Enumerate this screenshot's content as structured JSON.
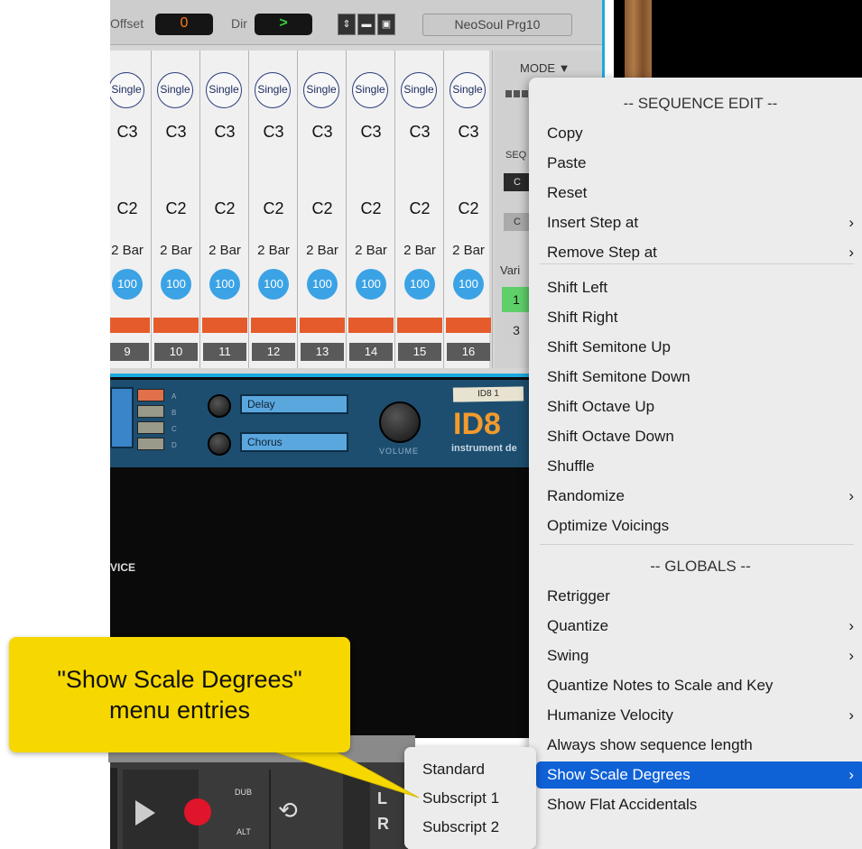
{
  "sequencer": {
    "offset_label": "Offset",
    "offset_value": "0",
    "dir_label": "Dir",
    "dir_value": ">",
    "preset_name": "NeoSoul Prg10",
    "mode_label": "MODE ▼",
    "partial_labels": {
      "seq": "SEQ",
      "c1": "C",
      "c2": "C",
      "var": "Vari",
      "v1": "1",
      "v3": "3"
    },
    "steps": [
      {
        "mode": "Single",
        "note_hi": "C3",
        "note_lo": "C2",
        "length": "2 Bar",
        "velocity": "100",
        "number": "9"
      },
      {
        "mode": "Single",
        "note_hi": "C3",
        "note_lo": "C2",
        "length": "2 Bar",
        "velocity": "100",
        "number": "10"
      },
      {
        "mode": "Single",
        "note_hi": "C3",
        "note_lo": "C2",
        "length": "2 Bar",
        "velocity": "100",
        "number": "11"
      },
      {
        "mode": "Single",
        "note_hi": "C3",
        "note_lo": "C2",
        "length": "2 Bar",
        "velocity": "100",
        "number": "12"
      },
      {
        "mode": "Single",
        "note_hi": "C3",
        "note_lo": "C2",
        "length": "2 Bar",
        "velocity": "100",
        "number": "13"
      },
      {
        "mode": "Single",
        "note_hi": "C3",
        "note_lo": "C2",
        "length": "2 Bar",
        "velocity": "100",
        "number": "14"
      },
      {
        "mode": "Single",
        "note_hi": "C3",
        "note_lo": "C2",
        "length": "2 Bar",
        "velocity": "100",
        "number": "15"
      },
      {
        "mode": "Single",
        "note_hi": "C3",
        "note_lo": "C2",
        "length": "2 Bar",
        "velocity": "100",
        "number": "16"
      }
    ]
  },
  "instrument": {
    "slot_letters": [
      "A",
      "B",
      "C",
      "D"
    ],
    "fx1": "Delay",
    "fx2": "Chorus",
    "volume_label": "VOLUME",
    "patch_label": "ID8 1",
    "logo": "ID8",
    "logo_sub": "instrument de",
    "partial_device_text": "VICE"
  },
  "transport": {
    "dub_label": "DUB",
    "alt_label": "ALT",
    "l_label": "L",
    "r_label": "R"
  },
  "menu": {
    "items": [
      {
        "label": "-- SEQUENCE EDIT --",
        "type": "header"
      },
      {
        "label": "Copy"
      },
      {
        "label": "Paste"
      },
      {
        "label": "Reset"
      },
      {
        "label": "Insert Step at",
        "submenu": true
      },
      {
        "label": "Remove Step at",
        "submenu": true
      },
      {
        "label": "Shift Left"
      },
      {
        "label": "Shift Right"
      },
      {
        "label": "Shift Semitone Up"
      },
      {
        "label": "Shift Semitone Down"
      },
      {
        "label": "Shift Octave Up"
      },
      {
        "label": "Shift Octave Down"
      },
      {
        "label": "Shuffle"
      },
      {
        "label": "Randomize",
        "submenu": true
      },
      {
        "label": "Optimize Voicings"
      },
      {
        "label": "-- GLOBALS --",
        "type": "header"
      },
      {
        "label": "Retrigger"
      },
      {
        "label": "Quantize",
        "submenu": true
      },
      {
        "label": "Swing",
        "submenu": true
      },
      {
        "label": "Quantize Notes to Scale and Key"
      },
      {
        "label": "Humanize Velocity",
        "submenu": true
      },
      {
        "label": "Always show sequence length"
      },
      {
        "label": "Show Scale Degrees",
        "submenu": true,
        "selected": true
      },
      {
        "label": "Show Flat Accidentals"
      }
    ],
    "chevron": "›"
  },
  "submenu": {
    "items": [
      "Standard",
      "Subscript 1",
      "Subscript 2"
    ]
  },
  "callout": {
    "line1": "\"Show Scale Degrees\"",
    "line2": "menu entries",
    "color": "#f6d800"
  },
  "colors": {
    "accent_blue": "#1aa9e0",
    "menu_selection": "#0f61d6",
    "gate_orange": "#e55b2c",
    "velocity_blue": "#3ba3e5"
  }
}
